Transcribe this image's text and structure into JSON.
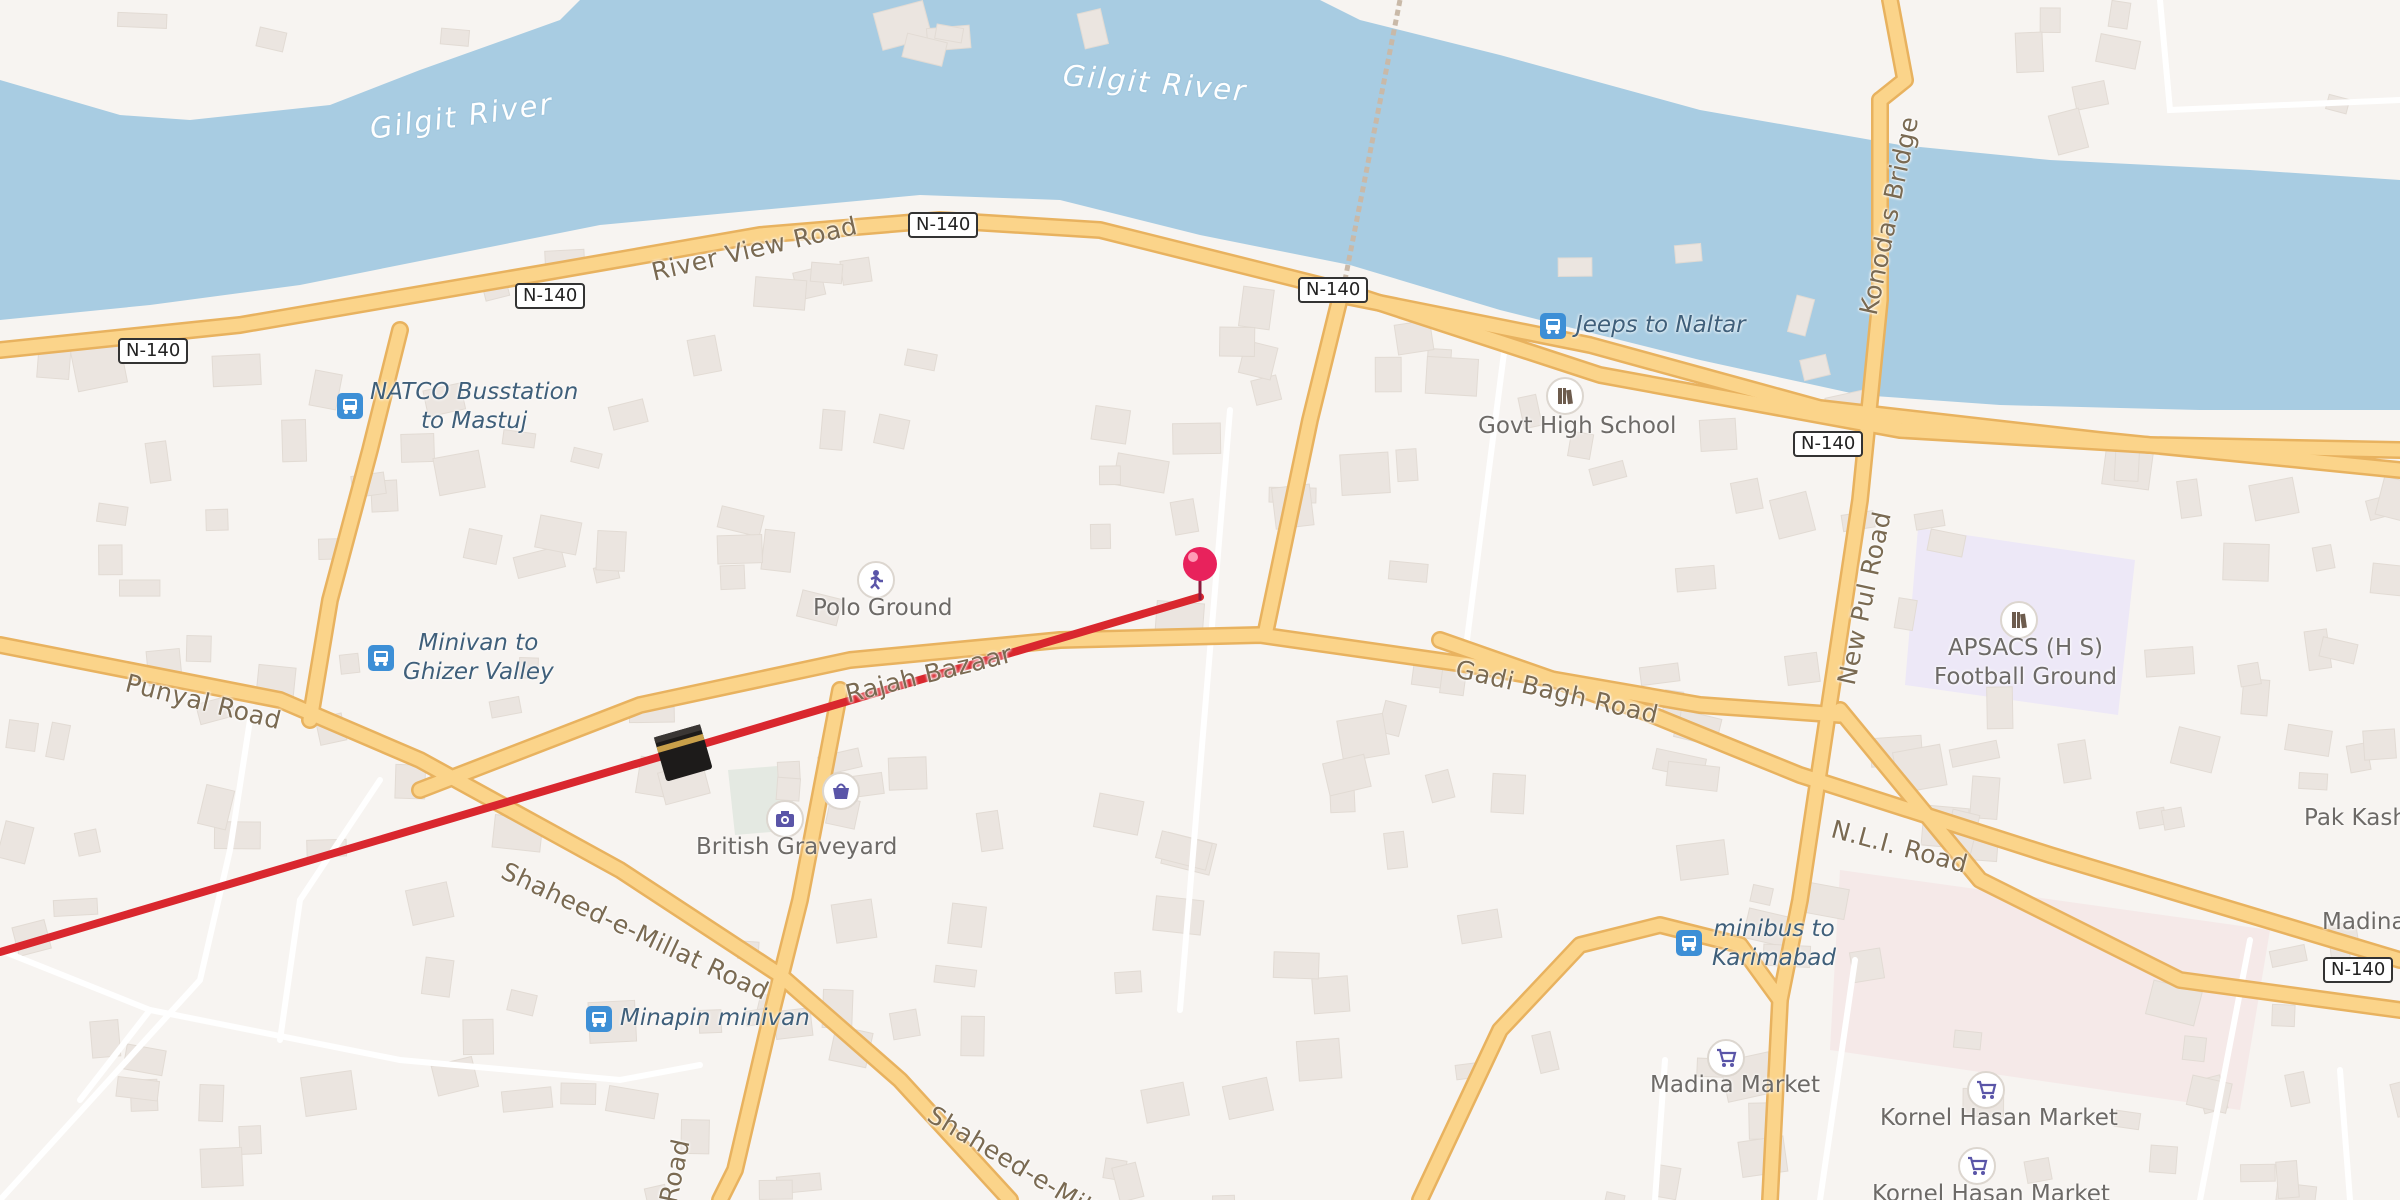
{
  "map": {
    "colors": {
      "land": "#f7f4f1",
      "water": "#a8cce2",
      "major_road": "#fbd48a",
      "major_road_casing": "#e8b25f",
      "minor_road": "#ffffff",
      "building": "#ebe5e0",
      "route_line": "#d9272e",
      "pin": "#e8225c",
      "school_area": "#ede8f7",
      "market_area": "#f4e6e6"
    },
    "water_labels": [
      "Gilgit River",
      "Gilgit River"
    ],
    "road_labels": {
      "river_view": "River View Road",
      "punyal": "Punyal Road",
      "rajah_bazaar": "Rajah Bazaar",
      "gadi_bagh": "Gadi Bagh Road",
      "shaheed_millat": "Shaheed-e-Millat Road",
      "shaheed_millat_2": "Shaheed-e-Millat",
      "konodas": "Konodas Bridge",
      "new_pul": "New Pul Road",
      "nli": "N.L.I. Road",
      "road_bottom": "Road"
    },
    "shields": [
      "N-140",
      "N-140",
      "N-140",
      "N-140",
      "N-140",
      "N-140"
    ],
    "pois": {
      "polo_ground": "Polo Ground",
      "british_graveyard": "British Graveyard",
      "govt_high_school": "Govt High School",
      "apsacs": "APSACS (H S)\nFootball Ground",
      "madina_market": "Madina Market",
      "kornel_hasan_market": "Kornel Hasan Market",
      "kornel_hasan_market_2": "Kornel Hasan Market",
      "pak_kash": "Pak Kash",
      "madina_edge": "Madina"
    },
    "bus_stops": {
      "natco": "NATCO Busstation\nto Mastuj",
      "minivan_ghizer": "Minivan to\nGhizer Valley",
      "minapin": "Minapin minivan",
      "jeeps_naltar": "Jeeps to Naltar",
      "minibus_karimabad": "minibus to\nKarimabad"
    },
    "icons": [
      "bus-stop-icon",
      "sports-icon",
      "camera-icon",
      "shopping-bag-icon",
      "school-icon",
      "shopping-cart-icon",
      "kaaba-icon",
      "location-pin-icon"
    ]
  }
}
